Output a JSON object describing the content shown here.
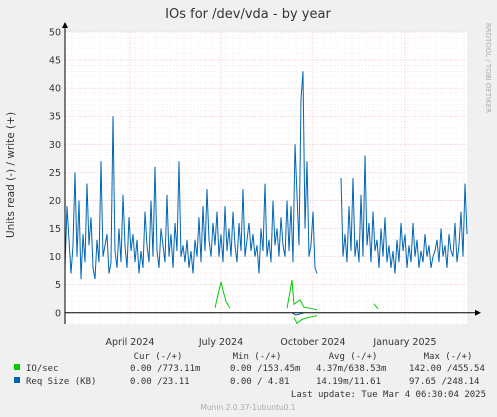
{
  "chart_data": {
    "type": "line",
    "title": "IOs for /dev/vda - by year",
    "ylabel": "Units read (-) / write (+)",
    "xlabel": "",
    "ylim": [
      -2,
      50
    ],
    "yticks": [
      0,
      5,
      10,
      15,
      20,
      25,
      30,
      35,
      40,
      45,
      50
    ],
    "x_range": [
      "2024-01-27",
      "2025-03-04"
    ],
    "xticks": [
      {
        "label": "April 2024",
        "date": "2024-04-01"
      },
      {
        "label": "July 2024",
        "date": "2024-07-01"
      },
      {
        "label": "October 2024",
        "date": "2024-10-01"
      },
      {
        "label": "January 2025",
        "date": "2025-01-01"
      }
    ],
    "grid": true,
    "side_label": "RRDTOOL / TOBI OETIKER",
    "series": [
      {
        "name": "IO/sec",
        "color": "#00cc00",
        "write_points": [
          [
            "2024-01-27",
            0.5
          ],
          [
            "2024-02-10",
            0.7
          ],
          [
            "2024-02-25",
            0.5
          ],
          [
            "2024-03-10",
            0.8
          ],
          [
            "2024-03-25",
            0.4
          ],
          [
            "2024-04-10",
            0.6
          ],
          [
            "2024-04-25",
            0.5
          ],
          [
            "2024-05-10",
            0.7
          ],
          [
            "2024-05-25",
            0.6
          ],
          [
            "2024-06-10",
            0.5
          ],
          [
            "2024-06-25",
            0.9
          ],
          [
            "2024-07-01",
            5.5
          ],
          [
            "2024-07-03",
            4.0
          ],
          [
            "2024-07-06",
            2.0
          ],
          [
            "2024-07-10",
            0.8
          ],
          [
            "2024-07-25",
            0.5
          ],
          [
            "2024-08-10",
            0.7
          ],
          [
            "2024-08-25",
            0.6
          ],
          [
            "2024-09-05",
            0.8
          ],
          [
            "2024-09-10",
            5.8
          ],
          [
            "2024-09-12",
            1.5
          ],
          [
            "2024-09-18",
            2.3
          ],
          [
            "2024-09-22",
            1.0
          ],
          [
            "2024-10-01",
            0.7
          ],
          [
            "2024-10-05",
            0.5
          ],
          [
            "2024-11-01",
            0.6
          ],
          [
            "2024-11-20",
            0.8
          ],
          [
            "2024-12-01",
            1.6
          ],
          [
            "2024-12-05",
            0.7
          ],
          [
            "2024-12-20",
            0.6
          ],
          [
            "2025-01-05",
            0.8
          ],
          [
            "2025-01-20",
            0.5
          ],
          [
            "2025-02-05",
            0.7
          ],
          [
            "2025-02-20",
            0.6
          ],
          [
            "2025-03-04",
            0.8
          ]
        ],
        "read_points": [
          [
            "2024-09-12",
            -0.8
          ],
          [
            "2024-09-15",
            -1.9
          ],
          [
            "2024-09-20",
            -1.2
          ],
          [
            "2024-09-25",
            -0.9
          ],
          [
            "2024-10-05",
            -0.5
          ]
        ]
      },
      {
        "name": "Req Size (KB)",
        "color": "#0066b3",
        "write_points": [
          [
            "2024-01-27",
            8
          ],
          [
            "2024-01-29",
            19
          ],
          [
            "2024-01-31",
            13
          ],
          [
            "2024-02-02",
            7
          ],
          [
            "2024-02-04",
            12
          ],
          [
            "2024-02-06",
            25
          ],
          [
            "2024-02-08",
            10
          ],
          [
            "2024-02-10",
            20
          ],
          [
            "2024-02-12",
            6
          ],
          [
            "2024-02-14",
            14
          ],
          [
            "2024-02-16",
            9
          ],
          [
            "2024-02-18",
            23
          ],
          [
            "2024-02-20",
            12
          ],
          [
            "2024-02-22",
            17
          ],
          [
            "2024-02-24",
            8
          ],
          [
            "2024-02-26",
            6
          ],
          [
            "2024-02-28",
            13
          ],
          [
            "2024-03-01",
            9
          ],
          [
            "2024-03-03",
            27
          ],
          [
            "2024-03-05",
            10
          ],
          [
            "2024-03-07",
            12
          ],
          [
            "2024-03-09",
            14
          ],
          [
            "2024-03-11",
            7
          ],
          [
            "2024-03-13",
            9
          ],
          [
            "2024-03-15",
            35
          ],
          [
            "2024-03-17",
            11
          ],
          [
            "2024-03-19",
            8
          ],
          [
            "2024-03-21",
            15
          ],
          [
            "2024-03-23",
            9
          ],
          [
            "2024-03-25",
            21
          ],
          [
            "2024-03-27",
            12
          ],
          [
            "2024-03-29",
            8
          ],
          [
            "2024-03-31",
            17
          ],
          [
            "2024-04-02",
            11
          ],
          [
            "2024-04-04",
            14
          ],
          [
            "2024-04-06",
            9
          ],
          [
            "2024-04-08",
            13
          ],
          [
            "2024-04-10",
            7
          ],
          [
            "2024-04-12",
            11
          ],
          [
            "2024-04-14",
            8
          ],
          [
            "2024-04-16",
            18
          ],
          [
            "2024-04-18",
            12
          ],
          [
            "2024-04-20",
            9
          ],
          [
            "2024-04-22",
            20
          ],
          [
            "2024-04-24",
            10
          ],
          [
            "2024-04-26",
            26
          ],
          [
            "2024-04-28",
            11
          ],
          [
            "2024-04-30",
            8
          ],
          [
            "2024-05-02",
            15
          ],
          [
            "2024-05-04",
            12
          ],
          [
            "2024-05-06",
            9
          ],
          [
            "2024-05-08",
            21
          ],
          [
            "2024-05-10",
            10
          ],
          [
            "2024-05-12",
            14
          ],
          [
            "2024-05-14",
            8
          ],
          [
            "2024-05-16",
            16
          ],
          [
            "2024-05-18",
            11
          ],
          [
            "2024-05-20",
            27
          ],
          [
            "2024-05-22",
            10
          ],
          [
            "2024-05-24",
            12
          ],
          [
            "2024-05-26",
            9
          ],
          [
            "2024-05-28",
            13
          ],
          [
            "2024-05-30",
            8
          ],
          [
            "2024-06-01",
            11
          ],
          [
            "2024-06-03",
            7
          ],
          [
            "2024-06-05",
            13
          ],
          [
            "2024-06-07",
            10
          ],
          [
            "2024-06-09",
            17
          ],
          [
            "2024-06-11",
            9
          ],
          [
            "2024-06-13",
            19
          ],
          [
            "2024-06-15",
            11
          ],
          [
            "2024-06-17",
            22
          ],
          [
            "2024-06-19",
            13
          ],
          [
            "2024-06-21",
            10
          ],
          [
            "2024-06-23",
            16
          ],
          [
            "2024-06-25",
            12
          ],
          [
            "2024-06-27",
            18
          ],
          [
            "2024-06-29",
            10
          ],
          [
            "2024-07-01",
            14
          ],
          [
            "2024-07-03",
            9
          ],
          [
            "2024-07-05",
            19
          ],
          [
            "2024-07-07",
            11
          ],
          [
            "2024-07-09",
            15
          ],
          [
            "2024-07-11",
            10
          ],
          [
            "2024-07-13",
            18
          ],
          [
            "2024-07-15",
            12
          ],
          [
            "2024-07-17",
            9
          ],
          [
            "2024-07-19",
            16
          ],
          [
            "2024-07-21",
            11
          ],
          [
            "2024-07-23",
            22
          ],
          [
            "2024-07-25",
            10
          ],
          [
            "2024-07-27",
            13
          ],
          [
            "2024-07-29",
            16
          ],
          [
            "2024-07-31",
            11
          ],
          [
            "2024-08-02",
            14
          ],
          [
            "2024-08-04",
            10
          ],
          [
            "2024-08-06",
            12
          ],
          [
            "2024-08-08",
            7
          ],
          [
            "2024-08-10",
            15
          ],
          [
            "2024-08-12",
            11
          ],
          [
            "2024-08-14",
            23
          ],
          [
            "2024-08-16",
            10
          ],
          [
            "2024-08-18",
            13
          ],
          [
            "2024-08-20",
            9
          ],
          [
            "2024-08-22",
            20
          ],
          [
            "2024-08-24",
            12
          ],
          [
            "2024-08-26",
            15
          ],
          [
            "2024-08-28",
            10
          ],
          [
            "2024-08-30",
            17
          ],
          [
            "2024-09-01",
            12
          ],
          [
            "2024-09-03",
            10
          ],
          [
            "2024-09-05",
            20
          ],
          [
            "2024-09-07",
            11
          ],
          [
            "2024-09-09",
            19
          ],
          [
            "2024-09-11",
            9
          ],
          [
            "2024-09-13",
            30
          ],
          [
            "2024-09-15",
            21
          ],
          [
            "2024-09-17",
            12
          ],
          [
            "2024-09-19",
            38
          ],
          [
            "2024-09-21",
            43
          ],
          [
            "2024-09-23",
            15
          ],
          [
            "2024-09-25",
            27
          ],
          [
            "2024-09-27",
            10
          ],
          [
            "2024-09-29",
            12
          ],
          [
            "2024-10-01",
            18
          ],
          [
            "2024-10-03",
            8
          ],
          [
            "2024-10-05",
            7
          ],
          [
            "2024-10-29",
            24
          ],
          [
            "2024-10-31",
            10
          ],
          [
            "2024-11-02",
            14
          ],
          [
            "2024-11-04",
            9
          ],
          [
            "2024-11-06",
            19
          ],
          [
            "2024-11-08",
            11
          ],
          [
            "2024-11-10",
            24
          ],
          [
            "2024-11-12",
            10
          ],
          [
            "2024-11-14",
            13
          ],
          [
            "2024-11-16",
            9
          ],
          [
            "2024-11-18",
            21
          ],
          [
            "2024-11-20",
            10
          ],
          [
            "2024-11-22",
            28
          ],
          [
            "2024-11-24",
            12
          ],
          [
            "2024-11-26",
            16
          ],
          [
            "2024-11-28",
            9
          ],
          [
            "2024-11-30",
            18
          ],
          [
            "2024-12-02",
            11
          ],
          [
            "2024-12-04",
            13
          ],
          [
            "2024-12-06",
            8
          ],
          [
            "2024-12-08",
            15
          ],
          [
            "2024-12-10",
            10
          ],
          [
            "2024-12-12",
            17
          ],
          [
            "2024-12-14",
            9
          ],
          [
            "2024-12-16",
            12
          ],
          [
            "2024-12-18",
            8
          ],
          [
            "2024-12-20",
            11
          ],
          [
            "2024-12-22",
            7
          ],
          [
            "2024-12-24",
            13
          ],
          [
            "2024-12-26",
            9
          ],
          [
            "2024-12-28",
            16
          ],
          [
            "2024-12-30",
            11
          ],
          [
            "2025-01-01",
            14
          ],
          [
            "2025-01-03",
            8
          ],
          [
            "2025-01-05",
            12
          ],
          [
            "2025-01-07",
            9
          ],
          [
            "2025-01-09",
            16
          ],
          [
            "2025-01-11",
            10
          ],
          [
            "2025-01-13",
            13
          ],
          [
            "2025-01-15",
            8
          ],
          [
            "2025-01-17",
            11
          ],
          [
            "2025-01-19",
            9
          ],
          [
            "2025-01-21",
            14
          ],
          [
            "2025-01-23",
            10
          ],
          [
            "2025-01-25",
            12
          ],
          [
            "2025-01-27",
            8
          ],
          [
            "2025-01-29",
            10
          ],
          [
            "2025-01-31",
            11
          ],
          [
            "2025-02-02",
            13
          ],
          [
            "2025-02-04",
            9
          ],
          [
            "2025-02-06",
            15
          ],
          [
            "2025-02-08",
            10
          ],
          [
            "2025-02-10",
            12
          ],
          [
            "2025-02-12",
            8
          ],
          [
            "2025-02-14",
            14
          ],
          [
            "2025-02-16",
            11
          ],
          [
            "2025-02-18",
            10
          ],
          [
            "2025-02-20",
            16
          ],
          [
            "2025-02-22",
            9
          ],
          [
            "2025-02-24",
            12
          ],
          [
            "2025-02-26",
            18
          ],
          [
            "2025-02-28",
            10
          ],
          [
            "2025-03-02",
            23
          ],
          [
            "2025-03-04",
            14
          ]
        ],
        "read_points": [
          [
            "2024-09-10",
            0
          ],
          [
            "2024-09-14",
            -0.4
          ],
          [
            "2024-09-18",
            -0.2
          ],
          [
            "2024-09-22",
            0
          ]
        ]
      }
    ],
    "legend": {
      "headers": [
        "Cur (-/+)",
        "Min (-/+)",
        "Avg (-/+)",
        "Max (-/+)"
      ],
      "rows": [
        {
          "name": "IO/sec",
          "color": "#00cc00",
          "cur": "0.00 /773.11m",
          "min": "0.00 /153.45m",
          "avg": "4.37m/638.53m",
          "max": "142.00 /455.54"
        },
        {
          "name": "Req Size (KB)",
          "color": "#0066b3",
          "cur": "0.00 /23.11",
          "min": "0.00 / 4.81",
          "avg": "14.19m/11.61",
          "max": "97.65 /248.14"
        }
      ]
    },
    "last_update": "Last update: Tue Mar  4 06:30:04 2025",
    "footer": "Munin 2.0.37-1ubuntu0.1"
  }
}
